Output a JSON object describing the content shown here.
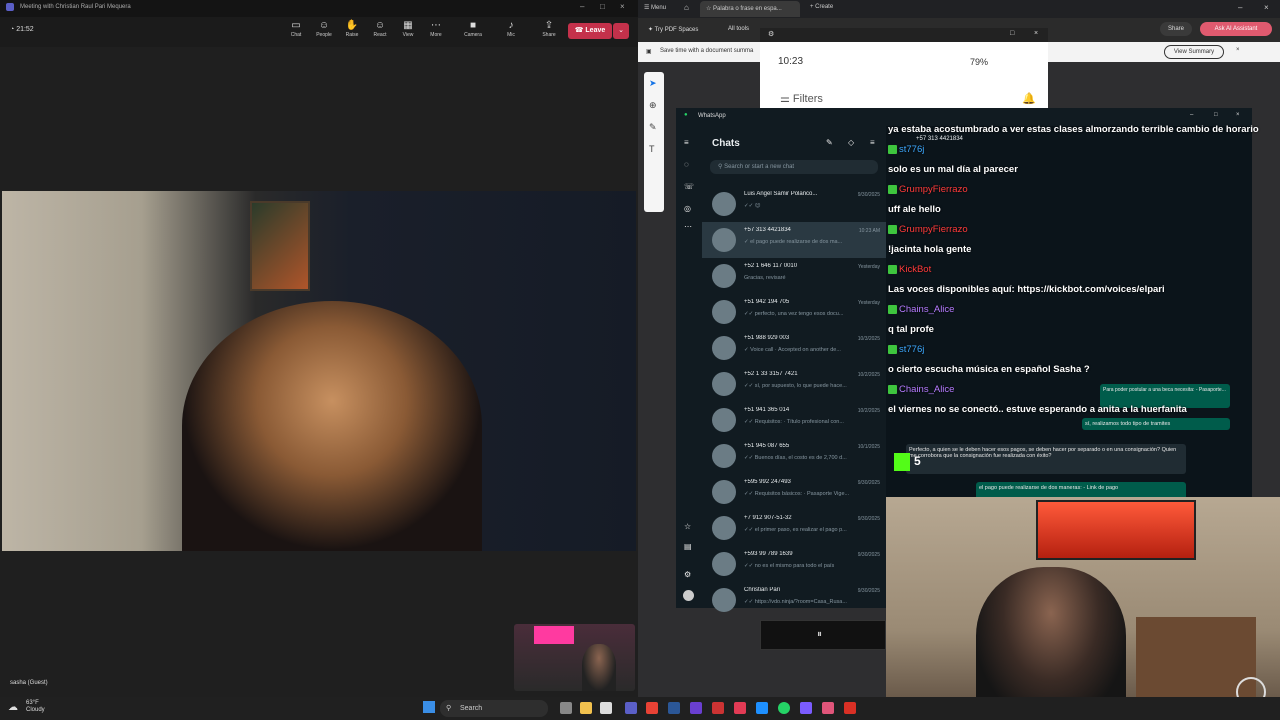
{
  "teams": {
    "window_title": "Meeting with Christian Raul Pari Mequera",
    "timer": "21:52",
    "toolbar": [
      {
        "label": "Chat",
        "icon": "chat-icon"
      },
      {
        "label": "People",
        "icon": "people-icon"
      },
      {
        "label": "Raise",
        "icon": "hand-icon"
      },
      {
        "label": "React",
        "icon": "smiley-icon"
      },
      {
        "label": "View",
        "icon": "grid-icon"
      },
      {
        "label": "More",
        "icon": "more-icon"
      },
      {
        "label": "Camera",
        "icon": "camera-icon"
      },
      {
        "label": "Mic",
        "icon": "mic-icon"
      },
      {
        "label": "Share",
        "icon": "share-icon"
      }
    ],
    "leave_label": "Leave",
    "participant_label": "sasha (Guest)"
  },
  "browser": {
    "menu_label": "Menu",
    "active_tab": "Palabra o frase en espa...",
    "create_label": "Create",
    "try_pdf": "Try PDF Spaces",
    "all_tools": "All tools",
    "share_label": "Share",
    "ask_ai": "Ask AI Assistant",
    "notification": "Save time with a document summa",
    "view_summary": "View Summary"
  },
  "phone": {
    "time": "10:23",
    "battery": "79%",
    "filters": "Filters"
  },
  "whatsapp": {
    "title": "WhatsApp",
    "chats_heading": "Chats",
    "search_placeholder": "Search or start a new chat",
    "chats": [
      {
        "name": "Luis Angel Samir Polanco...",
        "preview": "✓✓ 😊",
        "date": "9/30/2025"
      },
      {
        "name": "+57 313 4421834",
        "preview": "✓ el pago puede realizarse de dos ma...",
        "date": "10:23 AM"
      },
      {
        "name": "+52 1 646 117 0010",
        "preview": "Gracias, revisaré",
        "date": "Yesterday"
      },
      {
        "name": "+51 942 194 705",
        "preview": "✓✓ perfecto, una vez tengo esos docu...",
        "date": "Yesterday"
      },
      {
        "name": "+51 988 929 003",
        "preview": "✓ Voice call · Accepted on another de...",
        "date": "10/3/2025"
      },
      {
        "name": "+52 1 33 3157 7421",
        "preview": "✓✓ sí, por supuesto, lo que puede hace...",
        "date": "10/2/2025"
      },
      {
        "name": "+51 941 365 014",
        "preview": "✓✓ Requisitos: · Título profesional con...",
        "date": "10/2/2025"
      },
      {
        "name": "+51 945 087 655",
        "preview": "✓✓ Buenos días, el costo es de 2,700 d...",
        "date": "10/1/2025"
      },
      {
        "name": "+595 992 247493",
        "preview": "✓✓ Requisitos básicos: · Pasaporte Vige...",
        "date": "9/30/2025"
      },
      {
        "name": "+7 912 907-51-32",
        "preview": "✓✓ el primer paso, es realizar el pago p...",
        "date": "9/30/2025"
      },
      {
        "name": "+593 99 789 1639",
        "preview": "✓✓ no es el mismo para todo el país",
        "date": "9/30/2025"
      },
      {
        "name": "Christian Pari",
        "preview": "✓✓ https://vdo.ninja/?room=Casa_Rusa...",
        "date": "9/30/2025"
      }
    ],
    "contact_header": "+57 313 4421834",
    "bubbles": [
      "Para poder postular a una beca necesita: - Pasaporte...",
      "sí, realizamos todo tipo de tramites",
      "Perfecto, a quien se le deben hacer esos pagos, se deben hacer por separado o en una consignación? Quien me corrobora que la consignación fue realizada con éxito?",
      "el pago puede realizarse de dos maneras: - Link de pago"
    ]
  },
  "stream_chat": [
    {
      "type": "msg",
      "text": "ya estaba acostumbrado a ver estas clases almorzando terrible cambio de horario"
    },
    {
      "type": "user",
      "name": "st776j",
      "color": "#3da9ff"
    },
    {
      "type": "msg",
      "text": "solo es un mal día al parecer"
    },
    {
      "type": "user",
      "name": "GrumpyFierrazo",
      "color": "#ff3b3b"
    },
    {
      "type": "msg",
      "text": "uff ale hello"
    },
    {
      "type": "user",
      "name": "GrumpyFierrazo",
      "color": "#ff3b3b"
    },
    {
      "type": "msg",
      "text": "!jacinta hola gente"
    },
    {
      "type": "user",
      "name": "KickBot",
      "color": "#ff3b3b"
    },
    {
      "type": "msg",
      "text": "Las voces disponibles aquí: https://kickbot.com/voices/elpari"
    },
    {
      "type": "user",
      "name": "Chains_Alice",
      "color": "#b57bff"
    },
    {
      "type": "msg",
      "text": "q tal profe"
    },
    {
      "type": "user",
      "name": "st776j",
      "color": "#3da9ff"
    },
    {
      "type": "msg",
      "text": "o cierto escucha música en español Sasha ?"
    },
    {
      "type": "user",
      "name": "Chains_Alice",
      "color": "#b57bff"
    },
    {
      "type": "msg",
      "text": "el viernes no se conectó.. estuve esperando a anita a la huerfanita"
    }
  ],
  "viewer_count": "5",
  "taskbar": {
    "weather_temp": "63°F",
    "weather_desc": "Cloudy",
    "search_label": "Search"
  }
}
